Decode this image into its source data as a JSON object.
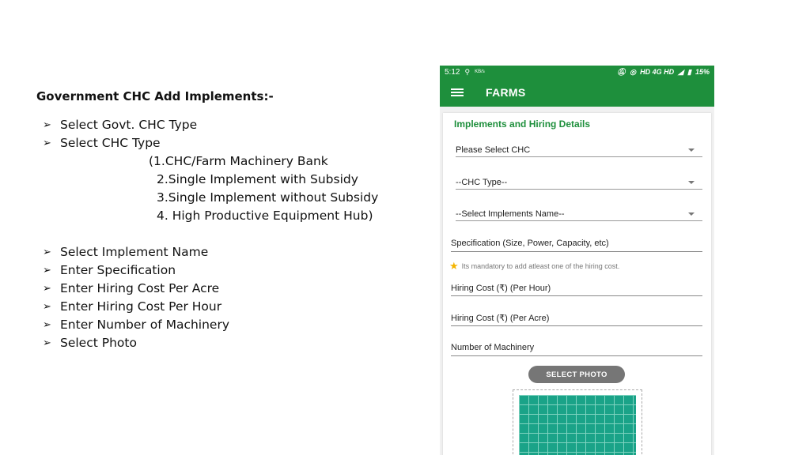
{
  "slide": {
    "title": "Government CHC Add Implements:-",
    "steps_a": [
      "Select Govt. CHC Type",
      "Select CHC Type"
    ],
    "chc_types": [
      "(1.CHC/Farm Machinery Bank",
      "2.Single Implement with Subsidy",
      "3.Single Implement without Subsidy",
      "4. High Productive Equipment Hub)"
    ],
    "steps_b": [
      "Select Implement Name",
      "Enter Specification",
      "Enter Hiring Cost Per Acre",
      "Enter Hiring Cost Per Hour",
      "Enter Number of Machinery",
      "Select Photo"
    ],
    "bullet_icon": "arrow-bullet-icon"
  },
  "phone": {
    "status": {
      "time": "5:12",
      "net_speed": "KB/s",
      "indicators": "HD 4G HD",
      "battery": "15%"
    },
    "appbar": {
      "title": "FARMS"
    },
    "form": {
      "heading": "Implements and Hiring Details",
      "chc_select": "Please Select CHC",
      "chc_type_select": "--CHC Type--",
      "implements_select": "--Select Implements Name--",
      "specification_placeholder": "Specification (Size, Power, Capacity, etc)",
      "mandatory_note": "Its mandatory to  add atleast one of the hiring cost.",
      "hiring_cost_hour_placeholder": "Hiring Cost (₹) (Per Hour)",
      "hiring_cost_acre_placeholder": "Hiring Cost (₹) (Per Acre)",
      "machinery_count_placeholder": "Number of Machinery",
      "select_photo_label": "SELECT PHOTO"
    },
    "colors": {
      "primary": "#1e8f3c",
      "button": "#767676",
      "photo": "#1aa388"
    }
  }
}
